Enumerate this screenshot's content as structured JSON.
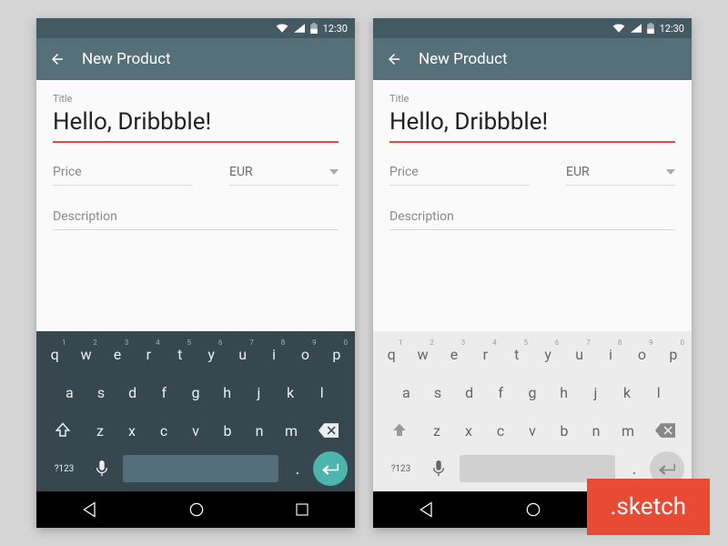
{
  "statusbar": {
    "time": "12:30"
  },
  "appbar": {
    "title": "New Product"
  },
  "form": {
    "title_label": "Title",
    "title_value": "Hello, Dribbble!",
    "price_label": "Price",
    "currency_value": "EUR",
    "description_label": "Description"
  },
  "keyboard": {
    "row1": [
      {
        "l": "q",
        "n": "1"
      },
      {
        "l": "w",
        "n": "2"
      },
      {
        "l": "e",
        "n": "3"
      },
      {
        "l": "r",
        "n": "4"
      },
      {
        "l": "t",
        "n": "5"
      },
      {
        "l": "y",
        "n": "6"
      },
      {
        "l": "u",
        "n": "7"
      },
      {
        "l": "i",
        "n": "8"
      },
      {
        "l": "o",
        "n": "9"
      },
      {
        "l": "p",
        "n": "0"
      }
    ],
    "row2": [
      "a",
      "s",
      "d",
      "f",
      "g",
      "h",
      "j",
      "k",
      "l"
    ],
    "row3": [
      "z",
      "x",
      "c",
      "v",
      "b",
      "n",
      "m"
    ],
    "sym": "?123",
    "period": "."
  },
  "badge": {
    "text": ".sketch"
  }
}
